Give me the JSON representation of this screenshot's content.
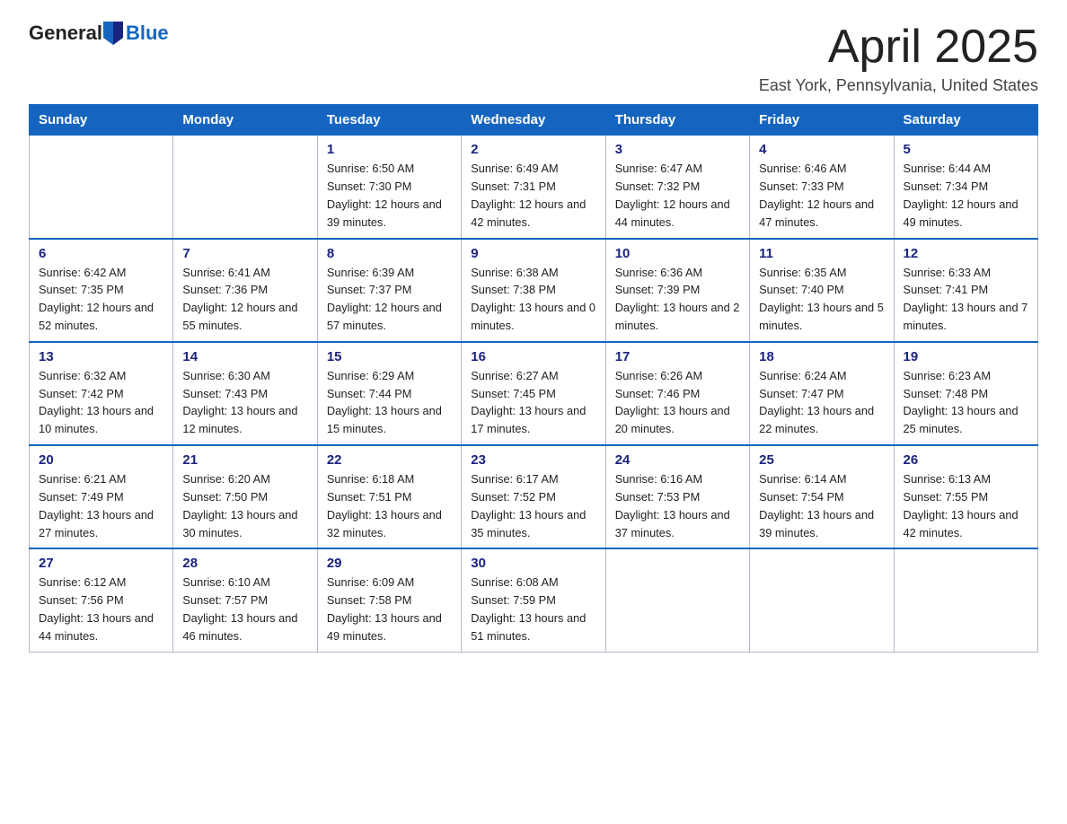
{
  "header": {
    "logo_general": "General",
    "logo_blue": "Blue",
    "month_title": "April 2025",
    "location": "East York, Pennsylvania, United States"
  },
  "weekdays": [
    "Sunday",
    "Monday",
    "Tuesday",
    "Wednesday",
    "Thursday",
    "Friday",
    "Saturday"
  ],
  "weeks": [
    [
      {
        "day": "",
        "info": ""
      },
      {
        "day": "",
        "info": ""
      },
      {
        "day": "1",
        "info": "Sunrise: 6:50 AM\nSunset: 7:30 PM\nDaylight: 12 hours\nand 39 minutes."
      },
      {
        "day": "2",
        "info": "Sunrise: 6:49 AM\nSunset: 7:31 PM\nDaylight: 12 hours\nand 42 minutes."
      },
      {
        "day": "3",
        "info": "Sunrise: 6:47 AM\nSunset: 7:32 PM\nDaylight: 12 hours\nand 44 minutes."
      },
      {
        "day": "4",
        "info": "Sunrise: 6:46 AM\nSunset: 7:33 PM\nDaylight: 12 hours\nand 47 minutes."
      },
      {
        "day": "5",
        "info": "Sunrise: 6:44 AM\nSunset: 7:34 PM\nDaylight: 12 hours\nand 49 minutes."
      }
    ],
    [
      {
        "day": "6",
        "info": "Sunrise: 6:42 AM\nSunset: 7:35 PM\nDaylight: 12 hours\nand 52 minutes."
      },
      {
        "day": "7",
        "info": "Sunrise: 6:41 AM\nSunset: 7:36 PM\nDaylight: 12 hours\nand 55 minutes."
      },
      {
        "day": "8",
        "info": "Sunrise: 6:39 AM\nSunset: 7:37 PM\nDaylight: 12 hours\nand 57 minutes."
      },
      {
        "day": "9",
        "info": "Sunrise: 6:38 AM\nSunset: 7:38 PM\nDaylight: 13 hours\nand 0 minutes."
      },
      {
        "day": "10",
        "info": "Sunrise: 6:36 AM\nSunset: 7:39 PM\nDaylight: 13 hours\nand 2 minutes."
      },
      {
        "day": "11",
        "info": "Sunrise: 6:35 AM\nSunset: 7:40 PM\nDaylight: 13 hours\nand 5 minutes."
      },
      {
        "day": "12",
        "info": "Sunrise: 6:33 AM\nSunset: 7:41 PM\nDaylight: 13 hours\nand 7 minutes."
      }
    ],
    [
      {
        "day": "13",
        "info": "Sunrise: 6:32 AM\nSunset: 7:42 PM\nDaylight: 13 hours\nand 10 minutes."
      },
      {
        "day": "14",
        "info": "Sunrise: 6:30 AM\nSunset: 7:43 PM\nDaylight: 13 hours\nand 12 minutes."
      },
      {
        "day": "15",
        "info": "Sunrise: 6:29 AM\nSunset: 7:44 PM\nDaylight: 13 hours\nand 15 minutes."
      },
      {
        "day": "16",
        "info": "Sunrise: 6:27 AM\nSunset: 7:45 PM\nDaylight: 13 hours\nand 17 minutes."
      },
      {
        "day": "17",
        "info": "Sunrise: 6:26 AM\nSunset: 7:46 PM\nDaylight: 13 hours\nand 20 minutes."
      },
      {
        "day": "18",
        "info": "Sunrise: 6:24 AM\nSunset: 7:47 PM\nDaylight: 13 hours\nand 22 minutes."
      },
      {
        "day": "19",
        "info": "Sunrise: 6:23 AM\nSunset: 7:48 PM\nDaylight: 13 hours\nand 25 minutes."
      }
    ],
    [
      {
        "day": "20",
        "info": "Sunrise: 6:21 AM\nSunset: 7:49 PM\nDaylight: 13 hours\nand 27 minutes."
      },
      {
        "day": "21",
        "info": "Sunrise: 6:20 AM\nSunset: 7:50 PM\nDaylight: 13 hours\nand 30 minutes."
      },
      {
        "day": "22",
        "info": "Sunrise: 6:18 AM\nSunset: 7:51 PM\nDaylight: 13 hours\nand 32 minutes."
      },
      {
        "day": "23",
        "info": "Sunrise: 6:17 AM\nSunset: 7:52 PM\nDaylight: 13 hours\nand 35 minutes."
      },
      {
        "day": "24",
        "info": "Sunrise: 6:16 AM\nSunset: 7:53 PM\nDaylight: 13 hours\nand 37 minutes."
      },
      {
        "day": "25",
        "info": "Sunrise: 6:14 AM\nSunset: 7:54 PM\nDaylight: 13 hours\nand 39 minutes."
      },
      {
        "day": "26",
        "info": "Sunrise: 6:13 AM\nSunset: 7:55 PM\nDaylight: 13 hours\nand 42 minutes."
      }
    ],
    [
      {
        "day": "27",
        "info": "Sunrise: 6:12 AM\nSunset: 7:56 PM\nDaylight: 13 hours\nand 44 minutes."
      },
      {
        "day": "28",
        "info": "Sunrise: 6:10 AM\nSunset: 7:57 PM\nDaylight: 13 hours\nand 46 minutes."
      },
      {
        "day": "29",
        "info": "Sunrise: 6:09 AM\nSunset: 7:58 PM\nDaylight: 13 hours\nand 49 minutes."
      },
      {
        "day": "30",
        "info": "Sunrise: 6:08 AM\nSunset: 7:59 PM\nDaylight: 13 hours\nand 51 minutes."
      },
      {
        "day": "",
        "info": ""
      },
      {
        "day": "",
        "info": ""
      },
      {
        "day": "",
        "info": ""
      }
    ]
  ]
}
